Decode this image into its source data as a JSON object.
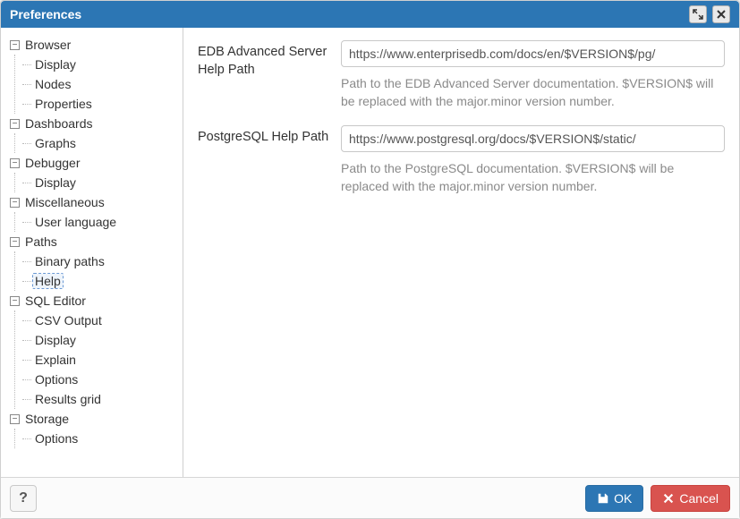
{
  "window": {
    "title": "Preferences"
  },
  "sidebar": {
    "selected_path": "Paths/Help",
    "groups": [
      {
        "label": "Browser",
        "items": [
          "Display",
          "Nodes",
          "Properties"
        ]
      },
      {
        "label": "Dashboards",
        "items": [
          "Graphs"
        ]
      },
      {
        "label": "Debugger",
        "items": [
          "Display"
        ]
      },
      {
        "label": "Miscellaneous",
        "items": [
          "User language"
        ]
      },
      {
        "label": "Paths",
        "items": [
          "Binary paths",
          "Help"
        ]
      },
      {
        "label": "SQL Editor",
        "items": [
          "CSV Output",
          "Display",
          "Explain",
          "Options",
          "Results grid"
        ]
      },
      {
        "label": "Storage",
        "items": [
          "Options"
        ]
      }
    ]
  },
  "content": {
    "fields": [
      {
        "label": "EDB Advanced Server Help Path",
        "value": "https://www.enterprisedb.com/docs/en/$VERSION$/pg/",
        "help": "Path to the EDB Advanced Server documentation. $VERSION$ will be replaced with the major.minor version number."
      },
      {
        "label": "PostgreSQL Help Path",
        "value": "https://www.postgresql.org/docs/$VERSION$/static/",
        "help": "Path to the PostgreSQL documentation. $VERSION$ will be replaced with the major.minor version number."
      }
    ]
  },
  "footer": {
    "help_label": "?",
    "ok_label": "OK",
    "cancel_label": "Cancel"
  }
}
